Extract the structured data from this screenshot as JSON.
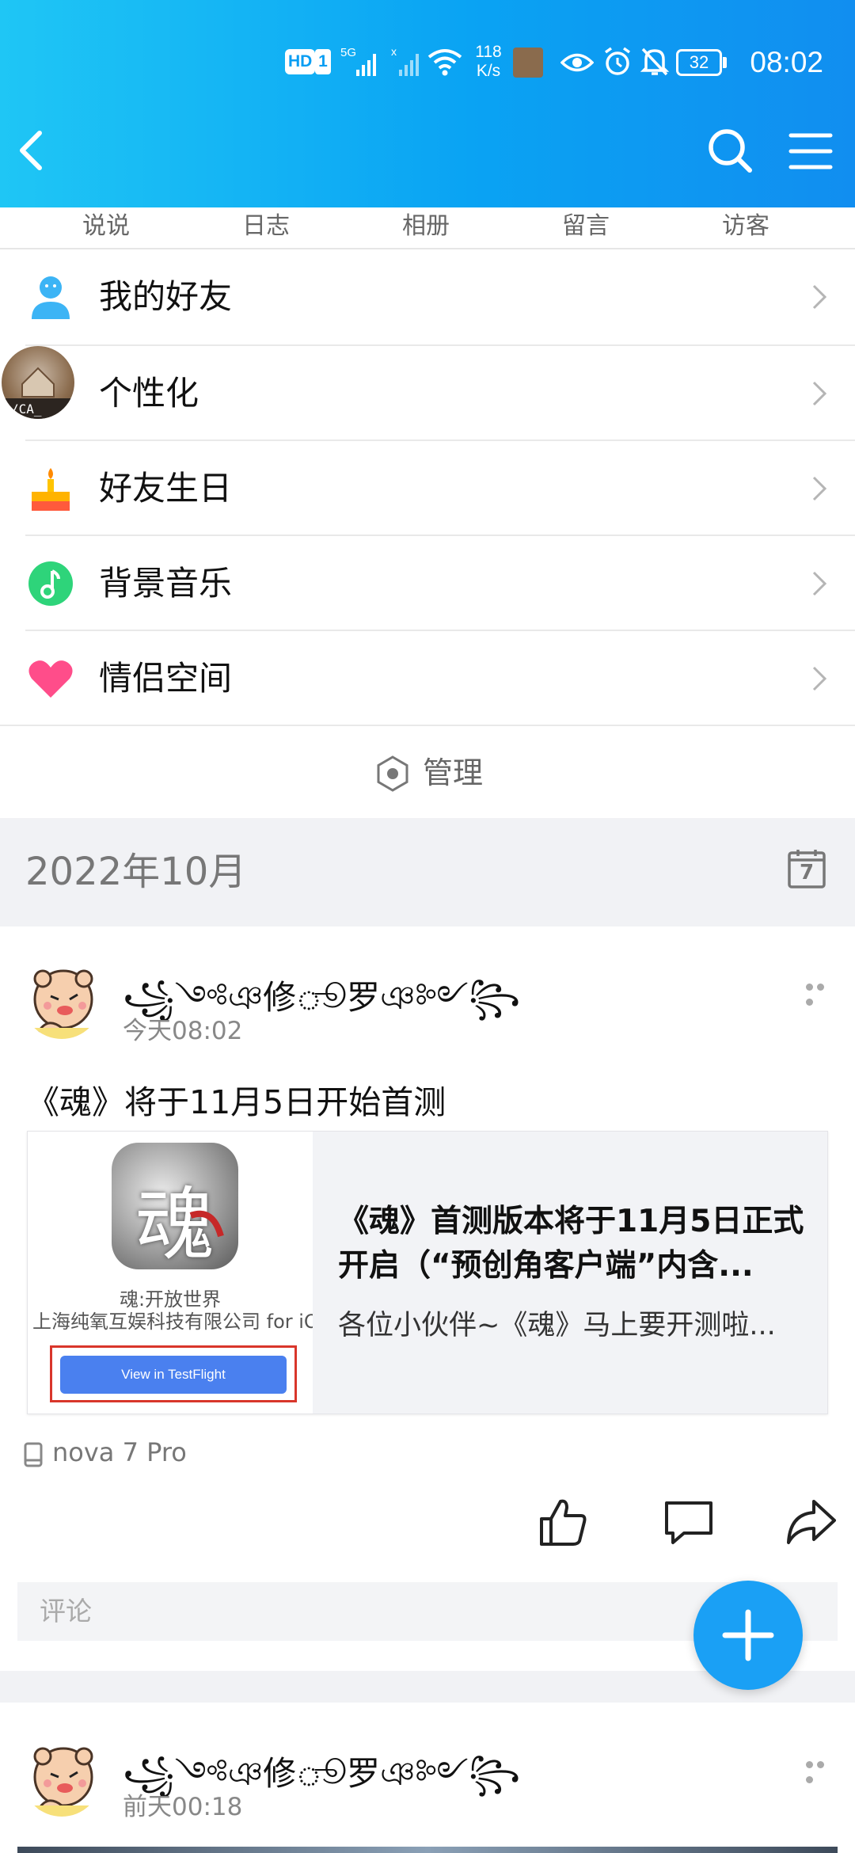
{
  "status_bar": {
    "hd_badge": "HD",
    "sim_badge": "1",
    "network": "5G",
    "net_speed_value": "118",
    "net_speed_unit": "K/s",
    "battery": "32",
    "time": "08:02"
  },
  "header": {
    "back_icon": "chevron-left-icon",
    "search_icon": "search-icon",
    "menu_icon": "hamburger-icon"
  },
  "tabs": [
    "说说",
    "日志",
    "相册",
    "留言",
    "访客"
  ],
  "menu": [
    {
      "label": "我的好友",
      "icon": "person-icon"
    },
    {
      "label": "个性化",
      "icon": "avatar-icon"
    },
    {
      "label": "好友生日",
      "icon": "cake-icon"
    },
    {
      "label": "背景音乐",
      "icon": "music-note-icon"
    },
    {
      "label": "情侣空间",
      "icon": "heart-icon"
    }
  ],
  "manage": {
    "label": "管理"
  },
  "month": {
    "label": "2022年10月",
    "calendar_day": "7"
  },
  "posts": [
    {
      "username": "꧁༺ঞ修ூ罗ঞ༻꧂",
      "time": "今天08:02",
      "text": "《魂》将于11月5日开始首测",
      "card": {
        "app_glyph": "魂",
        "app_name": "魂:开放世界",
        "company": "上海纯氧互娱科技有限公司 for iOS",
        "button": "View in TestFlight",
        "title": "《魂》首测版本将于11月5日正式开启（“预创角客户端”内含...",
        "desc": "各位小伙伴~《魂》马上要开测啦..."
      },
      "device": "nova 7 Pro",
      "comment_placeholder": "评论"
    },
    {
      "username": "꧁༺ঞ修ூ罗ঞ༻꧂",
      "time": "前天00:18"
    }
  ],
  "colors": {
    "header_start": "#1fc6f5",
    "header_end": "#118ef0",
    "fab": "#1aa0f5",
    "testflight_button": "#4a80ef"
  }
}
